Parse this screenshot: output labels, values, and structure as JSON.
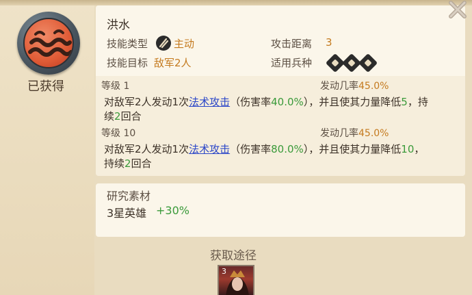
{
  "skill": {
    "name": "洪水",
    "obtained_label": "已获得",
    "type_label": "技能类型",
    "type_value": "主动",
    "target_label": "技能目标",
    "target_value": "敌军2人",
    "range_label": "攻击距离",
    "range_value": "3",
    "troop_label": "适用兵种",
    "troop_icons": [
      "infantry-icon",
      "cavalry-icon",
      "archer-icon"
    ]
  },
  "levels": [
    {
      "level_label": "等级 1",
      "rate_label": "发动几率",
      "rate_value": "45.0%",
      "desc_a": "对敌军2人发动1次",
      "link": "法术攻击",
      "desc_b": "（伤害率",
      "dmg": "40.0%",
      "desc_c": "），并且使其力量降低",
      "reduce": "5",
      "desc_d": "，持",
      "desc_e": "续",
      "turns": "2",
      "desc_f": "回合"
    },
    {
      "level_label": "等级 10",
      "rate_label": "发动几率",
      "rate_value": "45.0%",
      "desc_a": "对敌军2人发动1次",
      "link": "法术攻击",
      "desc_b": "（伤害率",
      "dmg": "80.0%",
      "desc_c": "），并且使其力量降低",
      "reduce": "10",
      "desc_d": "，",
      "desc_e": "持续",
      "turns": "2",
      "desc_f": "回合"
    }
  ],
  "research": {
    "label": "研究素材",
    "hero": "3星英雄",
    "bonus": "+30%"
  },
  "acquire": {
    "label": "获取途径",
    "hero_star": "3"
  },
  "colors": {
    "accent_orange": "#c47a1f",
    "link_blue": "#2b46c8",
    "positive_green": "#3a9a3a"
  }
}
